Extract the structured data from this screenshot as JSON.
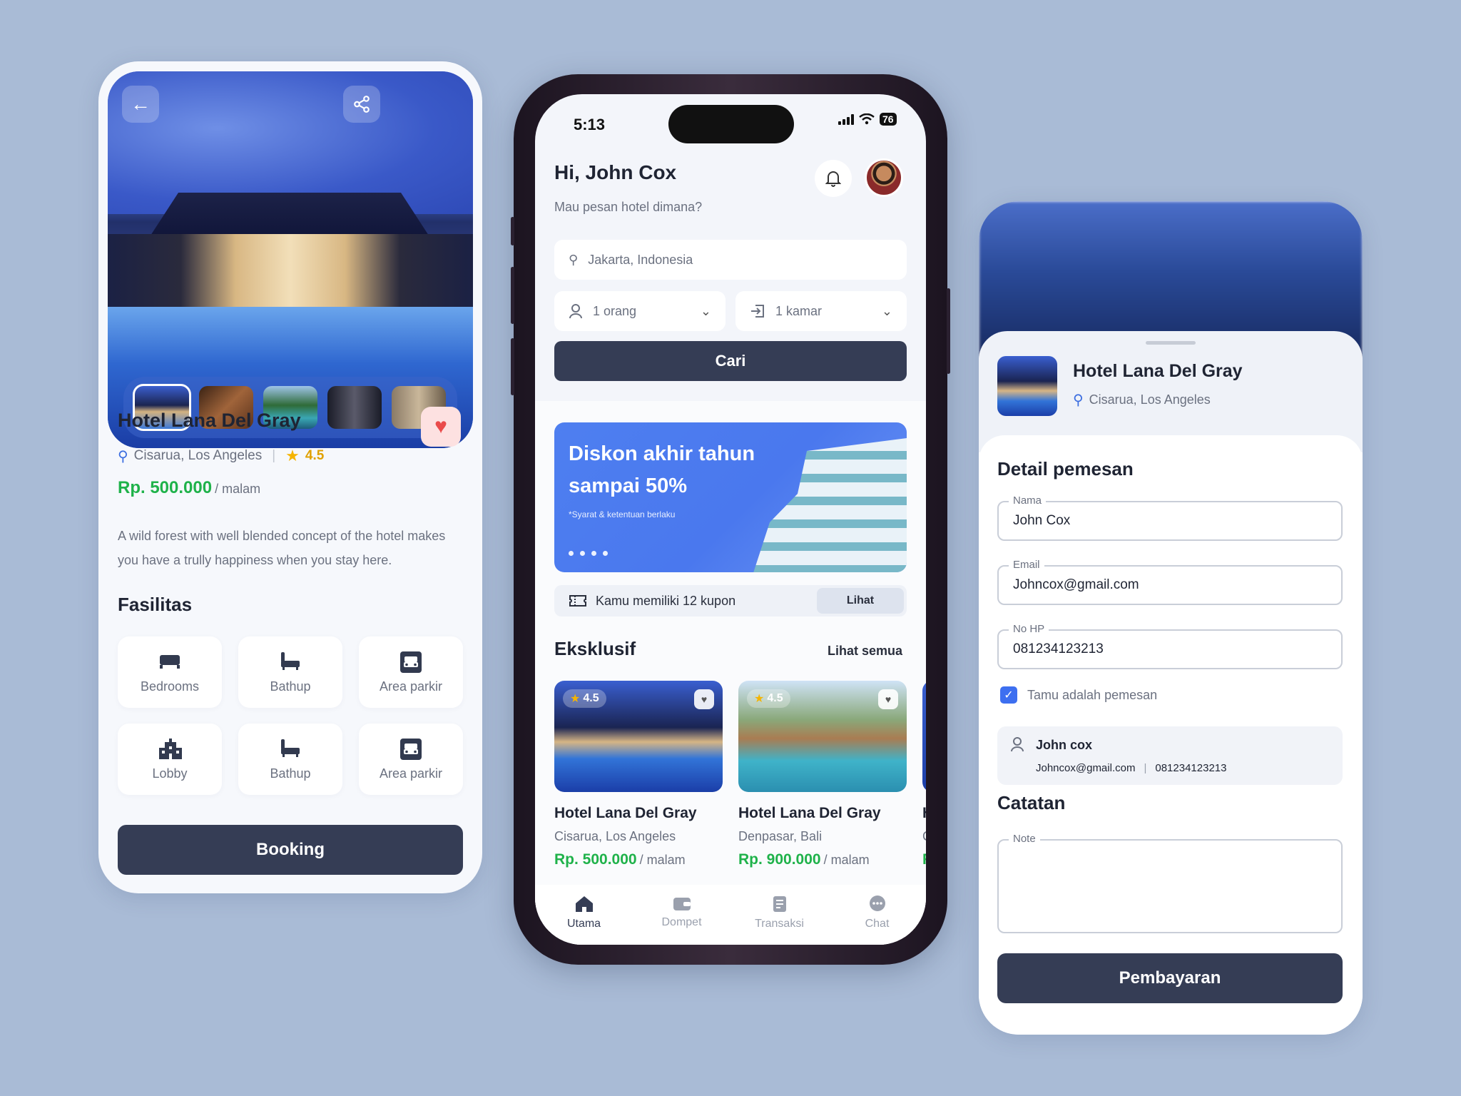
{
  "colors": {
    "background": "#a9bbd6",
    "primary_button": "#353d55",
    "price_green": "#1fb24a",
    "rating_gold": "#f5b400",
    "favorite_red": "#ea4b4b",
    "accent_blue": "#3d6ff0"
  },
  "detail_card": {
    "back_icon": "arrow-left-icon",
    "share_icon": "share-icon",
    "hotel_name": "Hotel Lana Del Gray",
    "location": "Cisarua, Los Angeles",
    "separator": "|",
    "rating": "4.5",
    "price": "Rp. 500.000",
    "price_unit": "/ malam",
    "description": "A wild forest with well blended concept of the hotel makes you have a trully happiness when you stay here.",
    "facilities_title": "Fasilitas",
    "facilities": [
      {
        "label": "Bedrooms",
        "icon": "bed-icon"
      },
      {
        "label": "Bathup",
        "icon": "bathtub-icon"
      },
      {
        "label": "Area parkir",
        "icon": "car-icon"
      },
      {
        "label": "Lobby",
        "icon": "building-icon"
      },
      {
        "label": "Bathup",
        "icon": "bathtub-icon"
      },
      {
        "label": "Area parkir",
        "icon": "car-icon"
      }
    ],
    "booking_label": "Booking"
  },
  "phone": {
    "status": {
      "time": "5:13",
      "battery": "76"
    },
    "greeting": "Hi, John Cox",
    "subtitle": "Mau pesan hotel dimana?",
    "search": {
      "location": "Jakarta, Indonesia",
      "guests": "1 orang",
      "rooms": "1 kamar",
      "button": "Cari"
    },
    "banner": {
      "title": "Diskon akhir tahun sampai 50%",
      "note": "*Syarat & ketentuan berlaku"
    },
    "coupon": {
      "text": "Kamu memiliki 12 kupon",
      "button": "Lihat"
    },
    "exclusive": {
      "title": "Eksklusif",
      "see_all": "Lihat semua",
      "cards": [
        {
          "name": "Hotel Lana Del Gray",
          "location": "Cisarua, Los Angeles",
          "price": "Rp. 500.000",
          "unit": "/ malam",
          "rating": "4.5"
        },
        {
          "name": "Hotel Lana Del Gray",
          "location": "Denpasar, Bali",
          "price": "Rp. 900.000",
          "unit": "/ malam",
          "rating": "4.5"
        },
        {
          "name": "H",
          "location": "C",
          "price": "R",
          "unit": "",
          "rating": ""
        }
      ]
    },
    "tabs": [
      {
        "label": "Utama",
        "icon": "home-icon"
      },
      {
        "label": "Dompet",
        "icon": "wallet-icon"
      },
      {
        "label": "Transaksi",
        "icon": "receipt-icon"
      },
      {
        "label": "Chat",
        "icon": "chat-icon"
      }
    ]
  },
  "booking_form": {
    "hotel_name": "Hotel Lana Del Gray",
    "location": "Cisarua, Los Angeles",
    "section_title": "Detail pemesan",
    "fields": {
      "name": {
        "label": "Nama",
        "value": "John Cox"
      },
      "email": {
        "label": "Email",
        "value": "Johncox@gmail.com"
      },
      "phone": {
        "label": "No HP",
        "value": "081234123213"
      }
    },
    "checkbox_label": "Tamu adalah pemesan",
    "guest": {
      "name": "John cox",
      "email": "Johncox@gmail.com",
      "separator": "|",
      "phone": "081234123213"
    },
    "notes_title": "Catatan",
    "note_label": "Note",
    "pay_button": "Pembayaran"
  }
}
